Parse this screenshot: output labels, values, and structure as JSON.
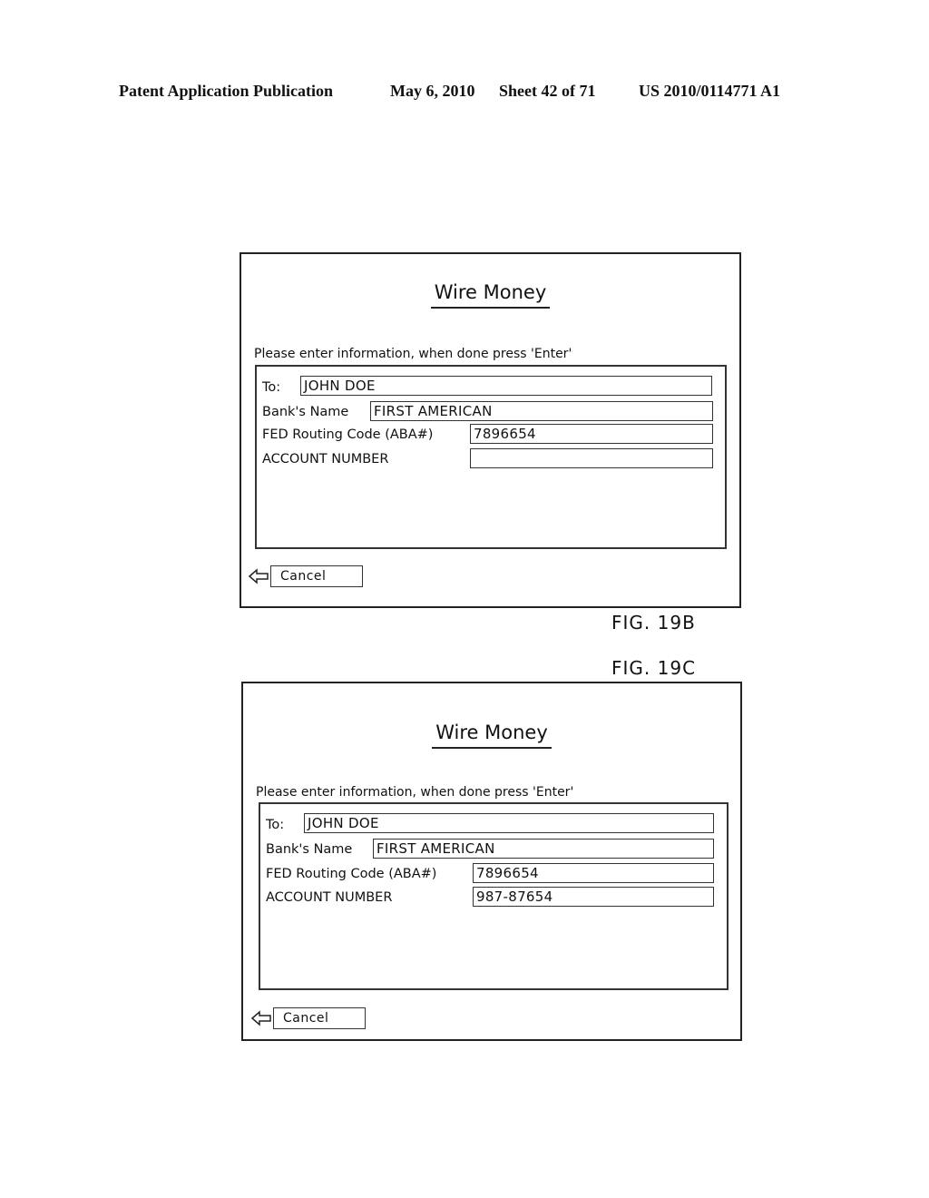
{
  "header": {
    "publication": "Patent Application Publication",
    "date": "May 6, 2010",
    "sheet": "Sheet 42 of 71",
    "number": "US 2010/0114771 A1"
  },
  "figures": [
    {
      "label": "FIG. 19B",
      "title": "Wire Money",
      "instruction": "Please enter information, when done press 'Enter'",
      "fields": [
        {
          "label": "To:",
          "value": "JOHN DOE"
        },
        {
          "label": "Bank's Name",
          "value": "FIRST AMERICAN"
        },
        {
          "label": "FED Routing Code (ABA#)",
          "value": "7896654"
        },
        {
          "label": "ACCOUNT NUMBER",
          "value": ""
        }
      ],
      "cancel_label": "Cancel",
      "back_icon": "left-arrow-icon"
    },
    {
      "label": "FIG. 19C",
      "title": "Wire Money",
      "instruction": "Please enter information, when done press 'Enter'",
      "fields": [
        {
          "label": "To:",
          "value": "JOHN DOE"
        },
        {
          "label": "Bank's Name",
          "value": "FIRST AMERICAN"
        },
        {
          "label": "FED Routing Code (ABA#)",
          "value": "7896654"
        },
        {
          "label": "ACCOUNT NUMBER",
          "value": "987-87654"
        }
      ],
      "cancel_label": "Cancel",
      "back_icon": "left-arrow-icon"
    }
  ]
}
